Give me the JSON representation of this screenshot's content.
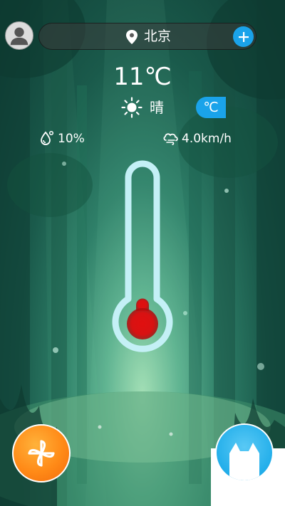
{
  "location": {
    "city": "北京"
  },
  "weather": {
    "temperature": "11℃",
    "condition": "晴",
    "unit_toggle": "℃",
    "humidity": "10%",
    "wind_speed": "4.0km/h"
  },
  "thermometer": {
    "level_fraction": 0.1
  },
  "icons": {
    "profile": "avatar-icon",
    "location": "location-pin-icon",
    "add": "plus-icon",
    "condition": "sun-icon",
    "humidity": "droplet-icon",
    "wind": "wind-icon",
    "fan": "pinwheel-icon",
    "cat": "cat-icon"
  },
  "colors": {
    "accent_blue": "#1aa3ea",
    "fan_orange": "#ff8a17",
    "mercury_red": "#e01010",
    "thermometer_outline": "#c4f0f6"
  }
}
